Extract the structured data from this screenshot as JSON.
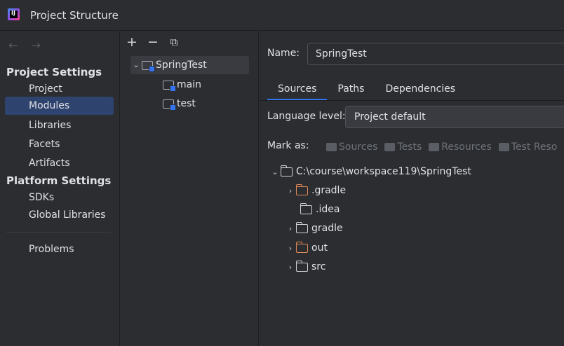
{
  "window": {
    "title": "Project Structure"
  },
  "sidebar": {
    "nav": {
      "back": "←",
      "forward": "→"
    },
    "project_settings_title": "Project Settings",
    "project_items": [
      "Project",
      "Modules",
      "Libraries",
      "Facets",
      "Artifacts"
    ],
    "platform_settings_title": "Platform Settings",
    "platform_items": [
      "SDKs",
      "Global Libraries"
    ],
    "other_items": [
      "Problems"
    ],
    "selected": "Modules"
  },
  "modules_panel": {
    "toolbar": {
      "add": "+",
      "remove": "−",
      "copy": "⧉"
    },
    "tree": {
      "root": "SpringTest",
      "children": [
        "main",
        "test"
      ]
    }
  },
  "module_details": {
    "name_label": "Name:",
    "name_value": "SpringTest",
    "tabs": [
      "Sources",
      "Paths",
      "Dependencies"
    ],
    "active_tab": "Sources",
    "language_level_label": "Language level:",
    "language_level_value": "Project default",
    "mark_as_label": "Mark as:",
    "mark_as_buttons": [
      "Sources",
      "Tests",
      "Resources",
      "Test Reso"
    ],
    "content_root": "C:\\course\\workspace119\\SpringTest",
    "content_children": [
      {
        "name": ".gradle",
        "expandable": true,
        "excluded": true
      },
      {
        "name": ".idea",
        "expandable": false,
        "excluded": false
      },
      {
        "name": "gradle",
        "expandable": true,
        "excluded": false
      },
      {
        "name": "out",
        "expandable": true,
        "excluded": true
      },
      {
        "name": "src",
        "expandable": true,
        "excluded": false
      }
    ]
  }
}
